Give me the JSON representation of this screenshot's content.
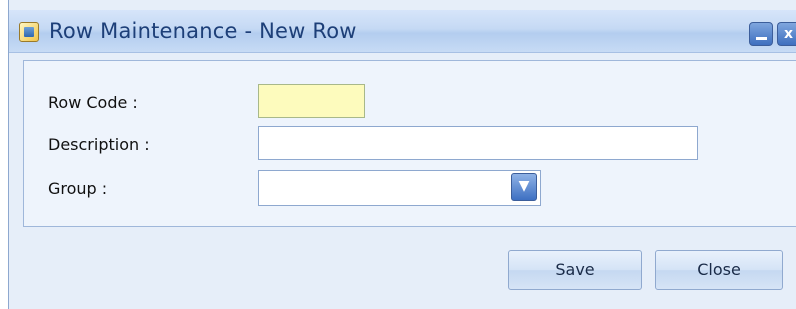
{
  "window": {
    "title": "Row Maintenance - New Row",
    "minimize_icon": "minimize-icon",
    "close_glyph": "x",
    "app_icon": "form-icon"
  },
  "form": {
    "row_code": {
      "label": "Row Code :",
      "value": ""
    },
    "description": {
      "label": "Description :",
      "value": ""
    },
    "group": {
      "label": "Group :",
      "value": "",
      "dropdown_icon": "chevron-down-icon"
    }
  },
  "buttons": {
    "save_label": "Save",
    "close_label": "Close"
  },
  "colors": {
    "title_text": "#1d3f78",
    "active_field_bg": "#fdfbbd",
    "window_bg": "#e6eef9"
  }
}
